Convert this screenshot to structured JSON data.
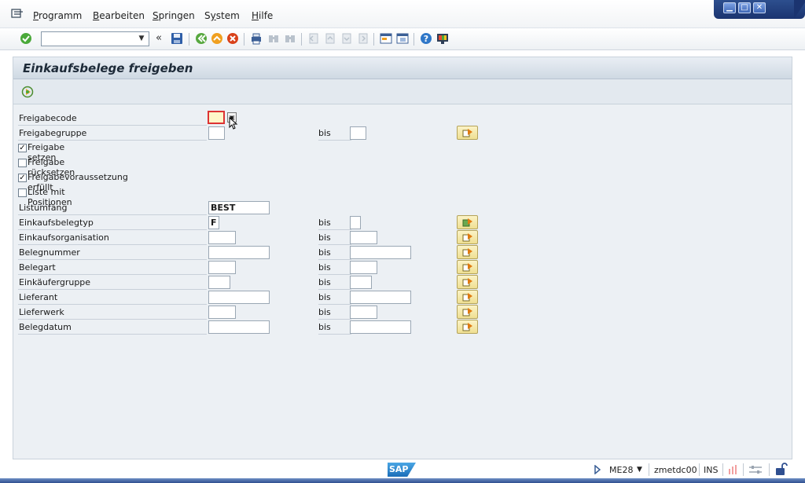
{
  "menu": {
    "items": [
      {
        "label": "Programm",
        "accel": "P"
      },
      {
        "label": "Bearbeiten",
        "accel": "B"
      },
      {
        "label": "Springen",
        "accel": "S"
      },
      {
        "label": "System",
        "accel": "y"
      },
      {
        "label": "Hilfe",
        "accel": "H"
      }
    ]
  },
  "toolbar": {
    "command_value": "",
    "back_label": "«",
    "icons": [
      "enter-icon",
      "save-icon",
      "back-icon",
      "exit-icon",
      "cancel-icon",
      "print-icon",
      "find-icon",
      "find-next-icon",
      "first-page-icon",
      "prev-page-icon",
      "next-page-icon",
      "last-page-icon",
      "new-session-icon",
      "shortcut-icon",
      "help-icon",
      "customize-layout-icon"
    ]
  },
  "screen": {
    "title": "Einkaufsbelege freigeben",
    "execute_icon": "execute-icon"
  },
  "form": {
    "freigabecode": {
      "label": "Freigabecode",
      "value": ""
    },
    "freigabegruppe": {
      "label": "Freigabegruppe",
      "from": "",
      "to_label": "bis",
      "to": ""
    },
    "checkboxes": [
      {
        "label": "Freigabe setzen",
        "checked": true
      },
      {
        "label": "Freigabe rücksetzen",
        "checked": false
      },
      {
        "label": "Freigabevoraussetzung erfüllt",
        "checked": true
      },
      {
        "label": "Liste mit Positionen",
        "checked": false
      }
    ],
    "listumfang": {
      "label": "Listumfang",
      "value": "BEST"
    },
    "ranges": [
      {
        "label": "Einkaufsbelegtyp",
        "from": "F",
        "to_label": "bis",
        "to": ""
      },
      {
        "label": "Einkaufsorganisation",
        "from": "",
        "to_label": "bis",
        "to": ""
      },
      {
        "label": "Belegnummer",
        "from": "",
        "to_label": "bis",
        "to": ""
      },
      {
        "label": "Belegart",
        "from": "",
        "to_label": "bis",
        "to": ""
      },
      {
        "label": "Einkäufergruppe",
        "from": "",
        "to_label": "bis",
        "to": ""
      },
      {
        "label": "Lieferant",
        "from": "",
        "to_label": "bis",
        "to": ""
      },
      {
        "label": "Lieferwerk",
        "from": "",
        "to_label": "bis",
        "to": ""
      },
      {
        "label": "Belegdatum",
        "from": "",
        "to_label": "bis",
        "to": ""
      }
    ]
  },
  "status": {
    "sap_logo": "SAP",
    "transaction": "ME28",
    "server": "zmetdc00",
    "mode": "INS"
  },
  "colors": {
    "accent": "#1b3470",
    "required_border": "#dd3333",
    "multi_button": "#efdf92"
  }
}
